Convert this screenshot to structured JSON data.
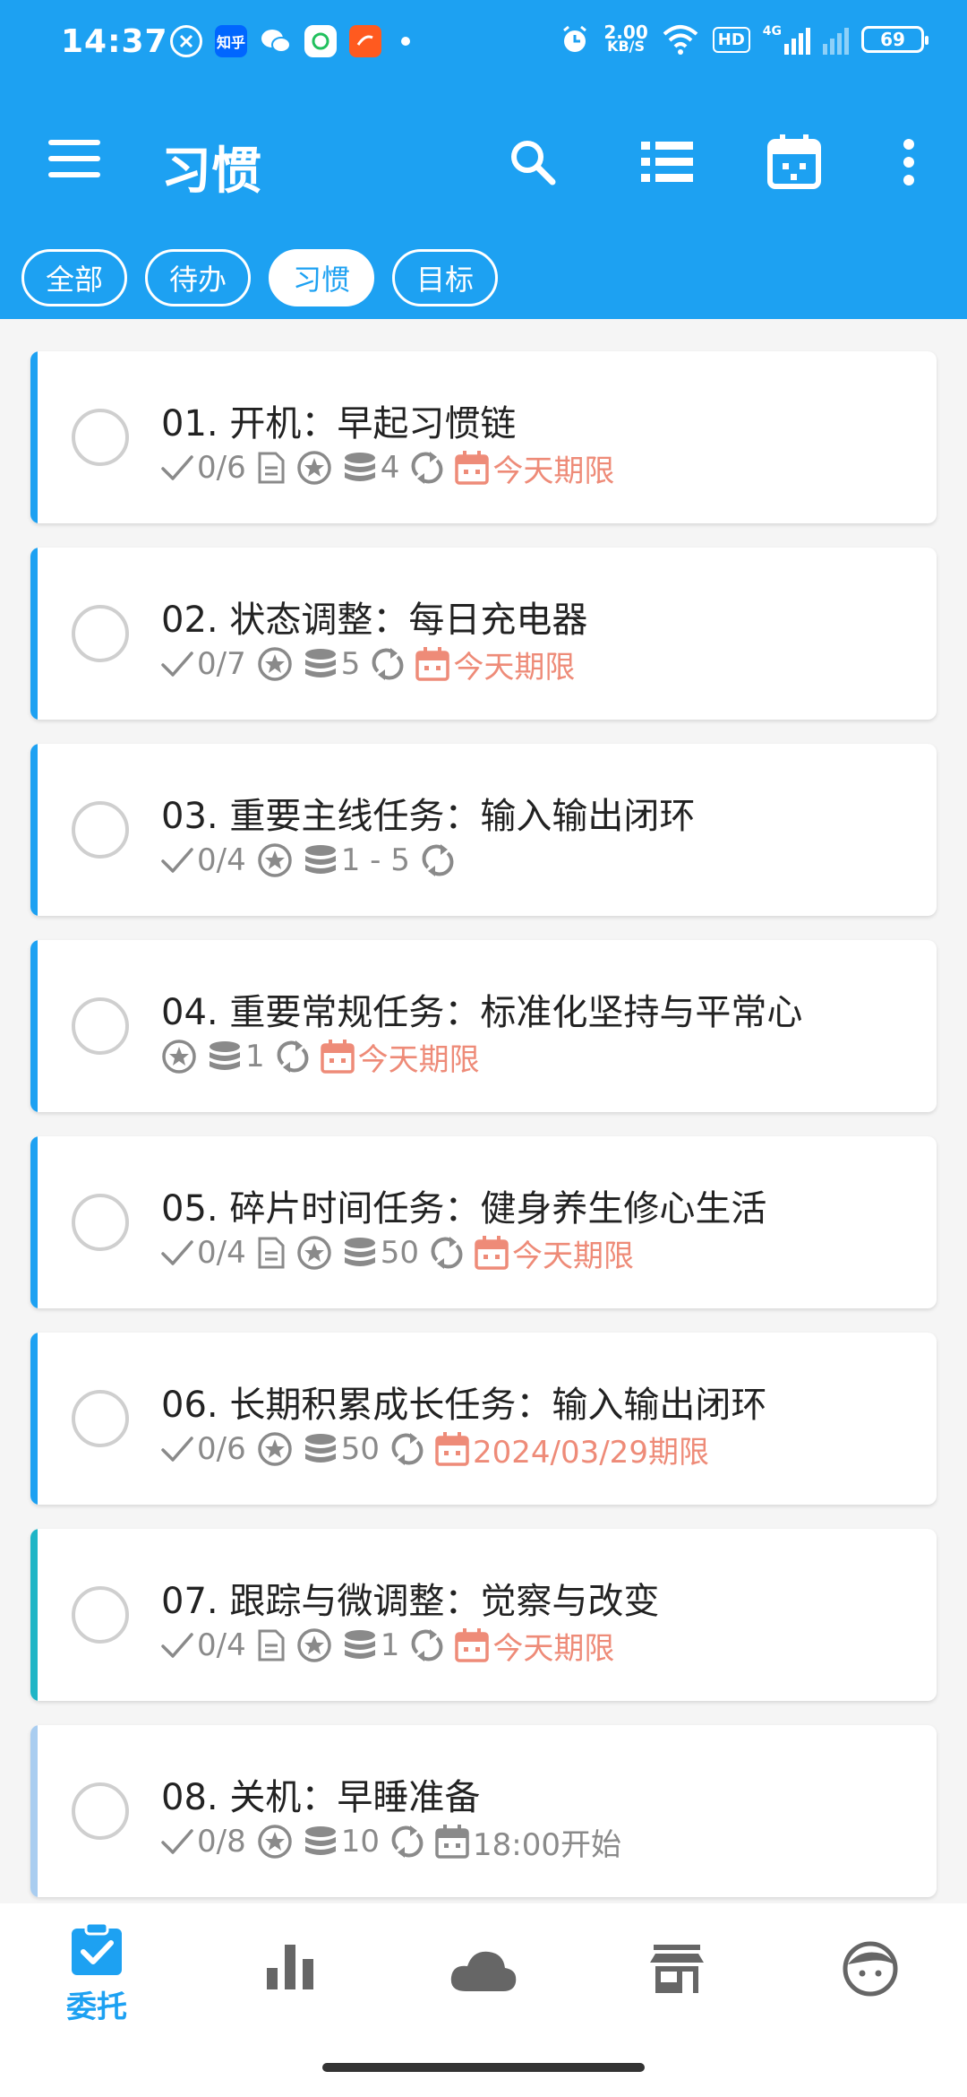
{
  "status": {
    "time": "14:37",
    "net_speed_value": "2.00",
    "net_speed_unit": "KB/S",
    "battery": "69",
    "hd": "HD",
    "sig": "4G"
  },
  "header": {
    "title": "习惯",
    "zhihu_badge": "知乎"
  },
  "chips": [
    {
      "label": "全部",
      "active": false
    },
    {
      "label": "待办",
      "active": false
    },
    {
      "label": "习惯",
      "active": true
    },
    {
      "label": "目标",
      "active": false
    }
  ],
  "tasks": [
    {
      "title": "01. 开机：早起习惯链",
      "progress": "0/6",
      "coins": "4",
      "due": "今天期限",
      "bar_color": "#1da1f2",
      "has_note": true
    },
    {
      "title": "02. 状态调整：每日充电器",
      "progress": "0/7",
      "coins": "5",
      "due": "今天期限",
      "bar_color": "#1da1f2",
      "has_note": false
    },
    {
      "title": "03. 重要主线任务：输入输出闭环",
      "progress": "0/4",
      "coins": "1 - 5",
      "due": "",
      "bar_color": "#1da1f2",
      "has_note": false
    },
    {
      "title": "04. 重要常规任务：标准化坚持与平常心",
      "progress": "",
      "coins": "1",
      "due": "今天期限",
      "bar_color": "#1da1f2",
      "has_note": false
    },
    {
      "title": "05. 碎片时间任务：健身养生修心生活",
      "progress": "0/4",
      "coins": "50",
      "due": "今天期限",
      "bar_color": "#1da1f2",
      "has_note": true
    },
    {
      "title": "06. 长期积累成长任务：输入输出闭环",
      "progress": "0/6",
      "coins": "50",
      "due": "2024/03/29期限",
      "bar_color": "#1da1f2",
      "has_note": false
    },
    {
      "title": "07. 跟踪与微调整：觉察与改变",
      "progress": "0/4",
      "coins": "1",
      "due": "今天期限",
      "bar_color": "#1fb5c6",
      "has_note": true
    },
    {
      "title": "08. 关机：早睡准备",
      "progress": "0/8",
      "coins": "10",
      "due": "18:00开始",
      "bar_color": "#a9cdf0",
      "has_note": false,
      "due_grey": true
    }
  ],
  "bottom_nav": {
    "items": [
      {
        "icon": "clipboard-check-icon",
        "label": "委托",
        "active": true
      },
      {
        "icon": "bar-chart-icon",
        "label": "",
        "active": false
      },
      {
        "icon": "cloud-icon",
        "label": "",
        "active": false
      },
      {
        "icon": "store-icon",
        "label": "",
        "active": false
      },
      {
        "icon": "avatar-face-icon",
        "label": "",
        "active": false
      }
    ]
  },
  "colors": {
    "primary": "#1da1f2",
    "due": "#ee8b78",
    "meta_grey": "#8a8a8a"
  }
}
